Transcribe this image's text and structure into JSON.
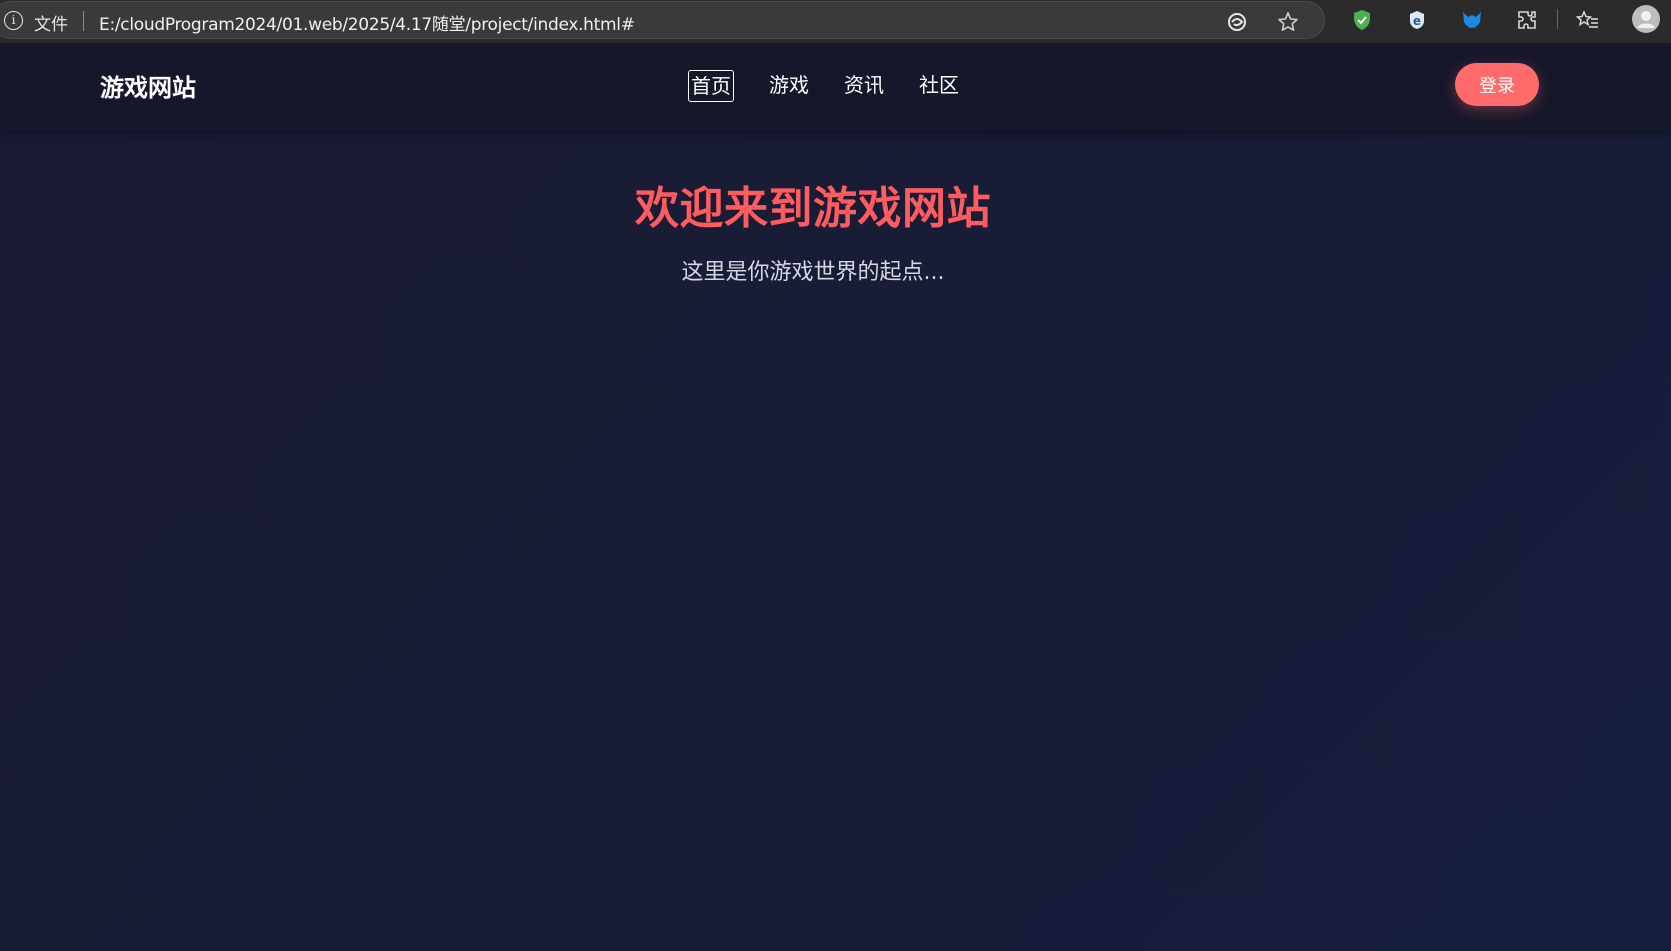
{
  "browser": {
    "info_icon": "i",
    "file_label": "文件",
    "url": "E:/cloudProgram2024/01.web/2025/4.17随堂/project/index.html#",
    "icons": [
      "read-aloud-icon",
      "favorite-star-icon",
      "shield-extension-icon",
      "edge-extension-icon",
      "blue-fox-extension-icon",
      "extensions-puzzle-icon",
      "favorites-list-icon",
      "profile-avatar-icon"
    ]
  },
  "navbar": {
    "logo": "游戏网站",
    "links": [
      {
        "label": "首页",
        "active": true
      },
      {
        "label": "游戏",
        "active": false
      },
      {
        "label": "资讯",
        "active": false
      },
      {
        "label": "社区",
        "active": false
      }
    ],
    "login_label": "登录"
  },
  "hero": {
    "title": "欢迎来到游戏网站",
    "subtitle": "这里是你游戏世界的起点..."
  },
  "colors": {
    "accent": "#ff6b6b",
    "title": "#ff5c5f",
    "background": "#181d35",
    "navbar": "#16172a"
  }
}
